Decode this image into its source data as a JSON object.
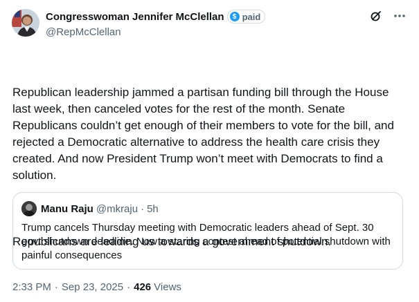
{
  "author": {
    "display_name": "Congresswoman Jennifer McClellan",
    "badge_label": "paid",
    "badge_symbol": "$",
    "handle": "@RepMcClellan"
  },
  "toolbar": {
    "icons": [
      "grok-icon",
      "more-icon"
    ]
  },
  "tweet": {
    "paragraph_1": "Republican leadership jammed a partisan funding bill through the House last week, then canceled votes for the rest of the month. Senate Republicans couldn’t get enough of their members to vote for the bill, and rejected a Democratic alternative to address the health care crisis they created. And now President Trump won’t meet with Democrats to find a solution.",
    "paragraph_2": "Republicans are leading us towards a government shutdown."
  },
  "quoted_tweet": {
    "display_name": "Manu Raju",
    "handle": "@mkraju",
    "separator": "·",
    "time": "5h",
    "text": "Trump cancels Thursday meeting with Democratic leaders ahead of Sept. 30 govt shutdown deadline. Now a staring contest ahead of potential shutdown with painful consequences"
  },
  "meta": {
    "time": "2:33 PM",
    "separator": "·",
    "date": "Sep 23, 2025",
    "separator_2": "·",
    "views_count": "426",
    "views_label": "Views"
  },
  "colors": {
    "text": "#0f1419",
    "secondary": "#536471",
    "border": "#cfd9de",
    "badge_blue": "#1d9bf0"
  }
}
